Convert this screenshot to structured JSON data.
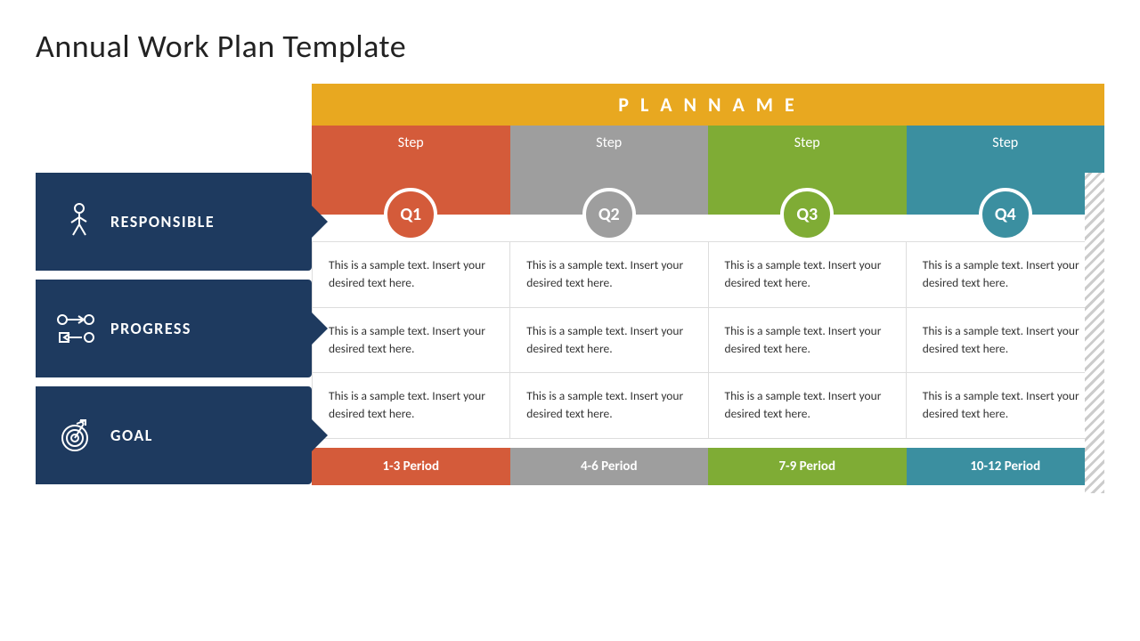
{
  "title": "Annual Work Plan Template",
  "plan_banner": "P L A N   N A M E",
  "steps": [
    {
      "id": "q1",
      "label": "Step",
      "circle": "Q1",
      "class": "q1"
    },
    {
      "id": "q2",
      "label": "Step",
      "circle": "Q2",
      "class": "q2"
    },
    {
      "id": "q3",
      "label": "Step",
      "circle": "Q3",
      "class": "q3"
    },
    {
      "id": "q4",
      "label": "Step",
      "circle": "Q4",
      "class": "q4"
    }
  ],
  "rows": [
    {
      "id": "responsible",
      "label": "RESPONSIBLE",
      "cells": [
        "This is a sample text. Insert your desired text here.",
        "This is a sample text. Insert your desired text here.",
        "This is a sample text. Insert your desired text here.",
        "This is a sample text. Insert your desired text here."
      ]
    },
    {
      "id": "progress",
      "label": "PROGRESS",
      "cells": [
        "This is a sample text. Insert your desired text here.",
        "This is a sample text. Insert your desired text here.",
        "This is a sample text. Insert your desired text here.",
        "This is a sample text. Insert your desired text here."
      ]
    },
    {
      "id": "goal",
      "label": "GOAL",
      "cells": [
        "This is a sample text. Insert your desired text here.",
        "This is a sample text. Insert your desired text here.",
        "This is a sample text. Insert your desired text here.",
        "This is a sample text. Insert your desired text here."
      ]
    }
  ],
  "periods": [
    {
      "label": "1-3 Period",
      "class": "p1"
    },
    {
      "label": "4-6 Period",
      "class": "p2"
    },
    {
      "label": "7-9 Period",
      "class": "p3"
    },
    {
      "label": "10-12 Period",
      "class": "p4"
    }
  ]
}
